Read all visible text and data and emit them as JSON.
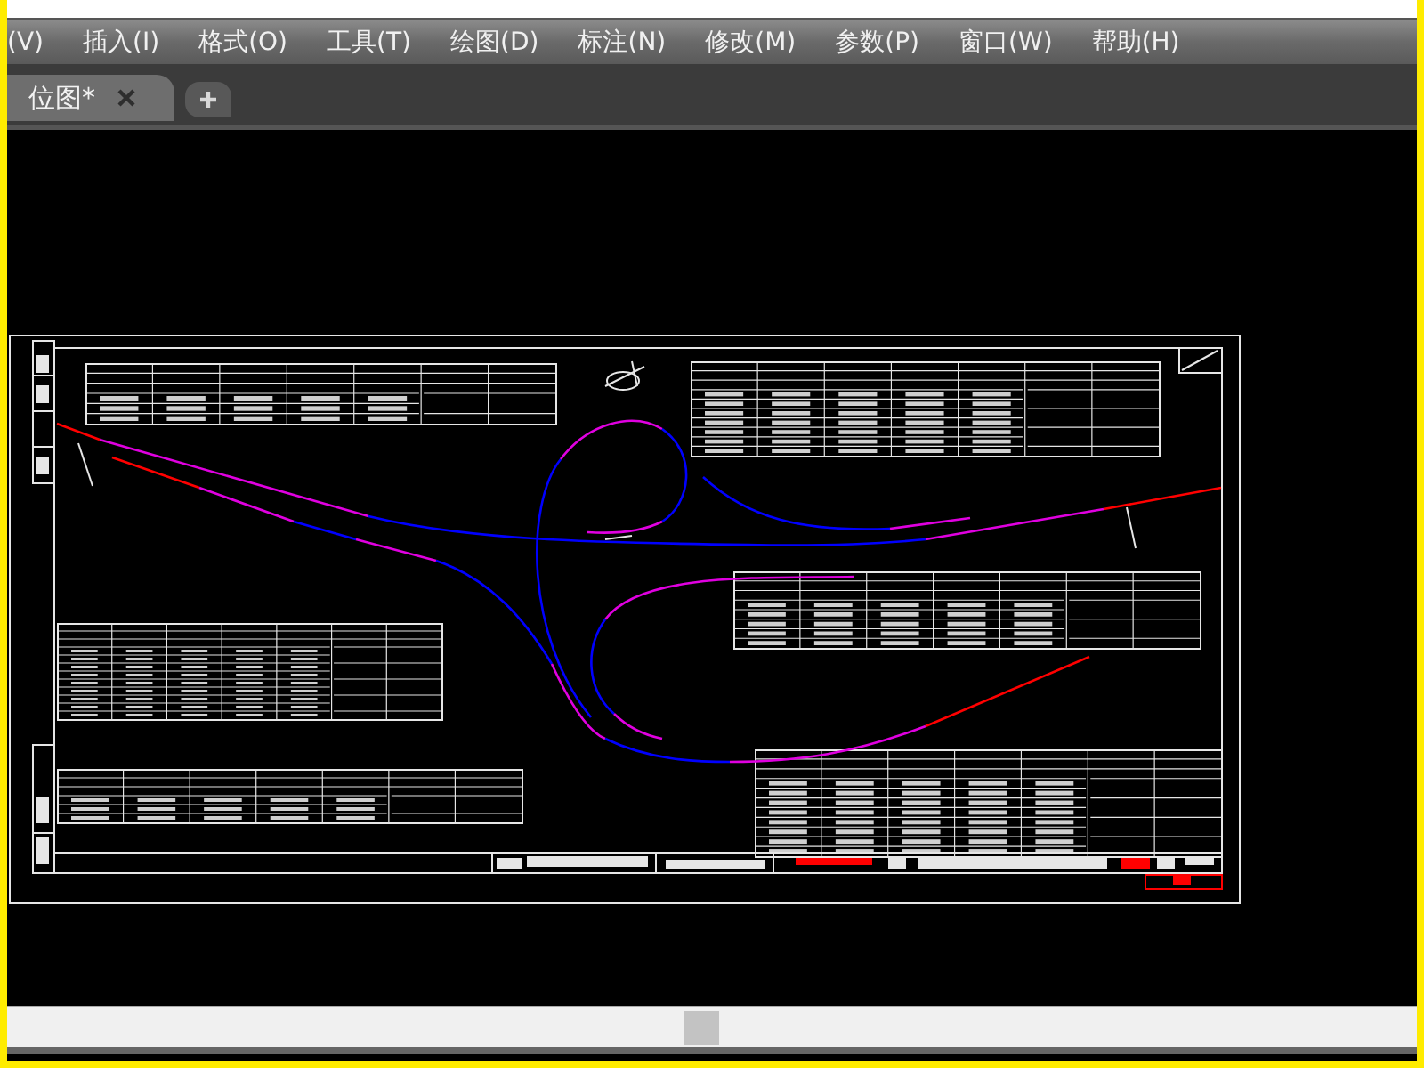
{
  "menu_bar": {
    "items": [
      {
        "label": "(V)"
      },
      {
        "label": "插入(I)"
      },
      {
        "label": "格式(O)"
      },
      {
        "label": "工具(T)"
      },
      {
        "label": "绘图(D)"
      },
      {
        "label": "标注(N)"
      },
      {
        "label": "修改(M)"
      },
      {
        "label": "参数(P)"
      },
      {
        "label": "窗口(W)"
      },
      {
        "label": "帮助(H)"
      }
    ]
  },
  "document_tabs": [
    {
      "label": "位图*",
      "selected": true
    }
  ]
}
